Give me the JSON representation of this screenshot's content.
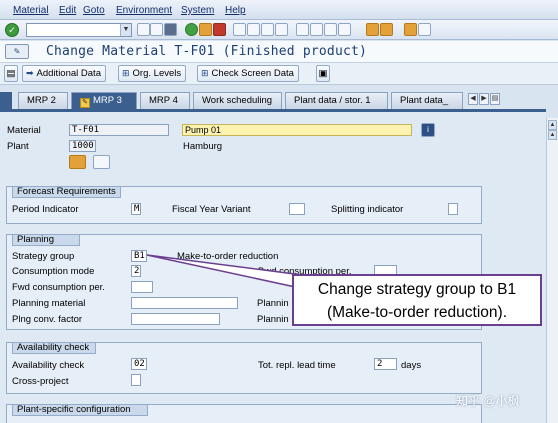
{
  "menu": [
    "Material",
    "Edit",
    "Goto",
    "Environment",
    "System",
    "Help"
  ],
  "title": "Change Material T-F01 (Finished product)",
  "app_toolbar": {
    "additional_data": "Additional Data",
    "org_levels": "Org. Levels",
    "check_screen_data": "Check Screen Data"
  },
  "tabs": [
    "MRP 2",
    "MRP 3",
    "MRP 4",
    "Work scheduling",
    "Plant data / stor. 1",
    "Plant data_"
  ],
  "header": {
    "material_label": "Material",
    "material_value": "T-F01",
    "material_desc": "Pump 01",
    "plant_label": "Plant",
    "plant_value": "1000",
    "plant_name": "Hamburg"
  },
  "forecast": {
    "title": "Forecast Requirements",
    "period_indicator_label": "Period Indicator",
    "period_indicator_value": "M",
    "fiscal_year_variant_label": "Fiscal Year Variant",
    "splitting_indicator_label": "Splitting indicator"
  },
  "planning": {
    "title": "Planning",
    "strategy_group_label": "Strategy group",
    "strategy_group_value": "B1",
    "strategy_group_desc": "Make-to-order reduction",
    "consumption_mode_label": "Consumption mode",
    "consumption_mode_value": "2",
    "bwd_consumption_label": "Bwd consumption per.",
    "fwd_consumption_label": "Fwd consumption per.",
    "planning_material_label": "Planning material",
    "planning_right_1": "Plannin",
    "plng_conv_factor_label": "Plng conv. factor",
    "planning_right_2": "Plannin"
  },
  "availability": {
    "title": "Availability check",
    "availability_check_label": "Availability check",
    "availability_check_value": "02",
    "tot_repl_label": "Tot. repl. lead time",
    "tot_repl_value": "2",
    "tot_repl_unit": "days",
    "cross_project_label": "Cross-project"
  },
  "plant_specific": {
    "title": "Plant-specific configuration"
  },
  "callout": {
    "line1": "Change strategy group to B1",
    "line2": "(Make-to-order reduction)."
  },
  "watermark": "知乎 @小枫",
  "colors": {
    "header_blue": "#3b5f8f",
    "panel_bg": "#dfe9f4",
    "callout_border": "#6b3f8f",
    "highlight_yellow": "#fdf3b0"
  }
}
